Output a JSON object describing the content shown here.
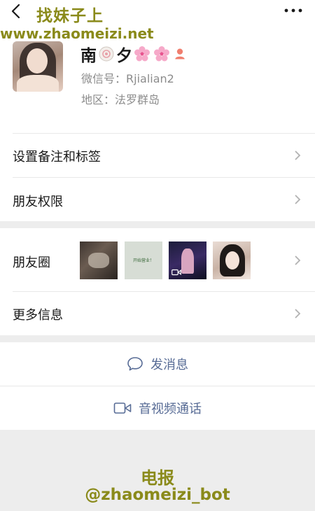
{
  "watermark": {
    "top_title": "找妹子上",
    "url": "www.zhaomeizi.net",
    "bottom_line1": "电报",
    "bottom_line2": "@zhaomeizi_bot"
  },
  "profile": {
    "nickname_part1": "南",
    "nickname_part2": "夕",
    "wechat_id": "微信号：Rjialian2",
    "region": "地区：法罗群岛"
  },
  "menu": {
    "remarks_label": "设置备注和标签",
    "permissions_label": "朋友权限",
    "moments_label": "朋友圈",
    "more_info_label": "更多信息"
  },
  "moments_thumbs": [
    "photo-dark-room",
    "text-card",
    "video-stage",
    "selfie-glasses"
  ],
  "moments_thumb2_text": "开始营业！",
  "actions": {
    "message_label": "发消息",
    "call_label": "音视频通话"
  },
  "colors": {
    "link_blue": "#576b95",
    "watermark_olive": "#8a8a1a",
    "background_gray": "#ededed"
  }
}
